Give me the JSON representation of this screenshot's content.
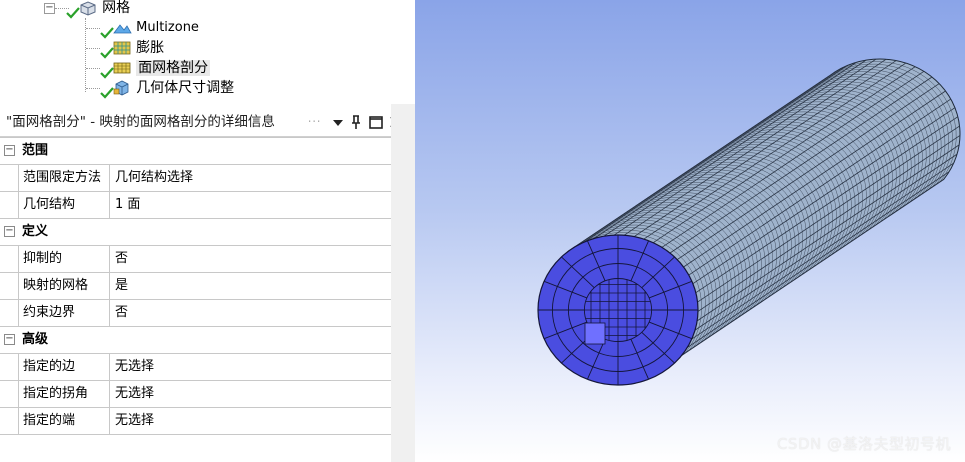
{
  "tree": {
    "root_label": "网格",
    "children": [
      {
        "label": "Multizone",
        "icon": "multizone-icon"
      },
      {
        "label": "膨胀",
        "icon": "inflation-icon"
      },
      {
        "label": "面网格剖分",
        "icon": "face-meshing-icon",
        "selected": true
      },
      {
        "label": "几何体尺寸调整",
        "icon": "body-sizing-icon"
      }
    ],
    "status_color": "#2aa12a"
  },
  "details": {
    "title": "\"面网格剖分\" - 映射的面网格剖分的详细信息",
    "dots": "⋅⋅⋅",
    "buttons": [
      "dropdown-icon",
      "pin-icon",
      "maximize-icon",
      "close-icon"
    ],
    "sections": [
      {
        "label": "范围",
        "toggle": "−",
        "rows": [
          {
            "name": "范围限定方法",
            "value": "几何结构选择"
          },
          {
            "name": "几何结构",
            "value": "1 面"
          }
        ]
      },
      {
        "label": "定义",
        "toggle": "−",
        "rows": [
          {
            "name": "抑制的",
            "value": "否"
          },
          {
            "name": "映射的网格",
            "value": "是"
          },
          {
            "name": "约束边界",
            "value": "否"
          }
        ]
      },
      {
        "label": "高级",
        "toggle": "−",
        "rows": [
          {
            "name": "指定的边",
            "value": "无选择"
          },
          {
            "name": "指定的拐角",
            "value": "无选择"
          },
          {
            "name": "指定的端",
            "value": "无选择"
          }
        ]
      }
    ]
  },
  "viewport": {
    "watermark": "CSDN @基洛夫型初号机",
    "mesh_color": "#4a4de0",
    "body_color": "#9fb3cc",
    "selected_face_color": "#6f70ff"
  }
}
